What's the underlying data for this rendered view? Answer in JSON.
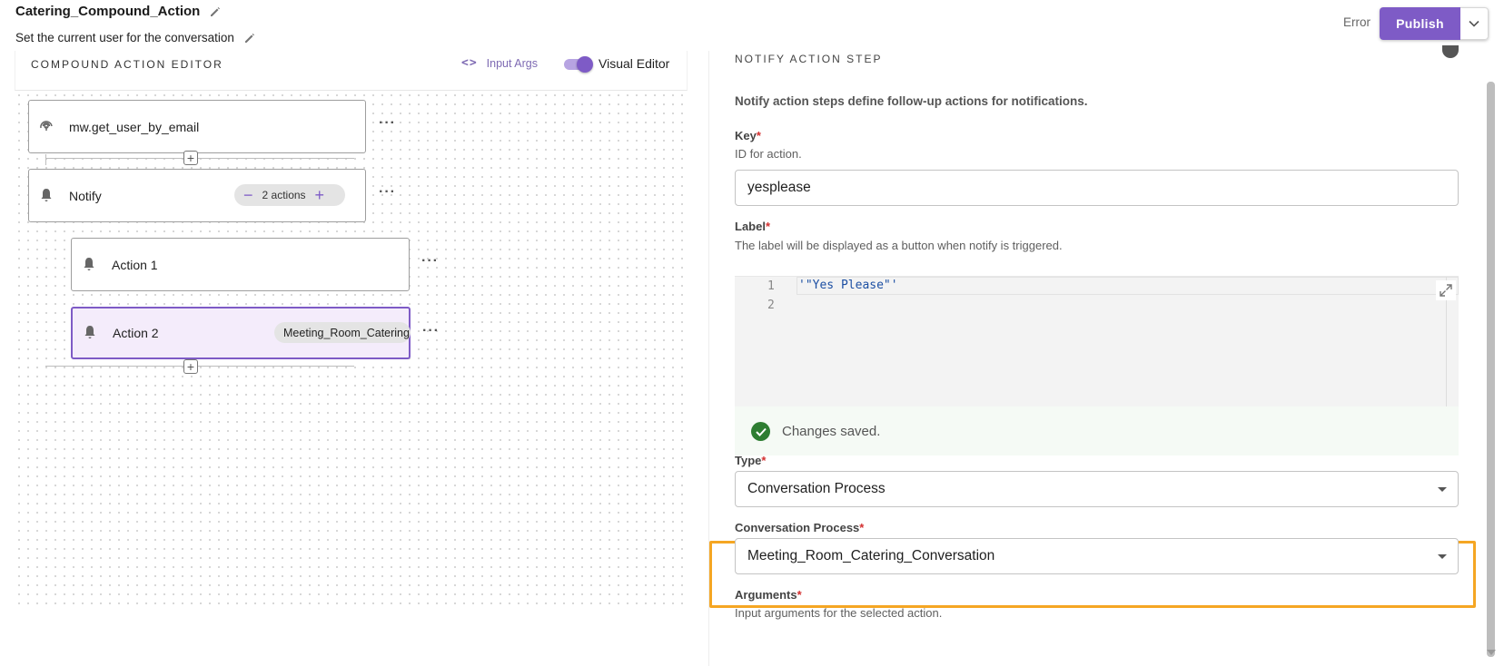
{
  "header": {
    "title": "Catering_Compound_Action",
    "subtitle": "Set the current user for the conversation",
    "status": "Error",
    "publish_label": "Publish"
  },
  "editor": {
    "section_label": "COMPOUND ACTION EDITOR",
    "input_args_label": "Input Args",
    "visual_editor_label": "Visual Editor",
    "visual_editor_on": true
  },
  "nodes": {
    "step1": {
      "label": "mw.get_user_by_email",
      "icon": "fingerprint-icon"
    },
    "step2": {
      "label": "Notify",
      "icon": "bell-icon",
      "actions_count": "2 actions"
    },
    "action1": {
      "label": "Action 1",
      "icon": "bell-icon"
    },
    "action2": {
      "label": "Action 2",
      "icon": "bell-icon",
      "chip": "Meeting_Room_Catering_Conversation"
    }
  },
  "panel": {
    "section_title": "NOTIFY ACTION STEP",
    "description": "Notify action steps define follow-up actions for notifications.",
    "key": {
      "label": "Key",
      "help": "ID for action.",
      "value": "yesplease"
    },
    "label_field": {
      "label": "Label",
      "help": "The label will be displayed as a button when notify is triggered.",
      "line_numbers": [
        "1",
        "2"
      ],
      "code": "'\"Yes Please\"'"
    },
    "saved_message": "Changes saved.",
    "type": {
      "label": "Type",
      "value": "Conversation Process"
    },
    "conversation_process": {
      "label": "Conversation Process",
      "value": "Meeting_Room_Catering_Conversation"
    },
    "arguments": {
      "label": "Arguments",
      "help": "Input arguments for the selected action."
    },
    "required_marker": "*"
  },
  "colors": {
    "accent": "#7e5bc6",
    "highlight": "#f5a623",
    "success": "#2e7d32",
    "required": "#d32f2f"
  }
}
